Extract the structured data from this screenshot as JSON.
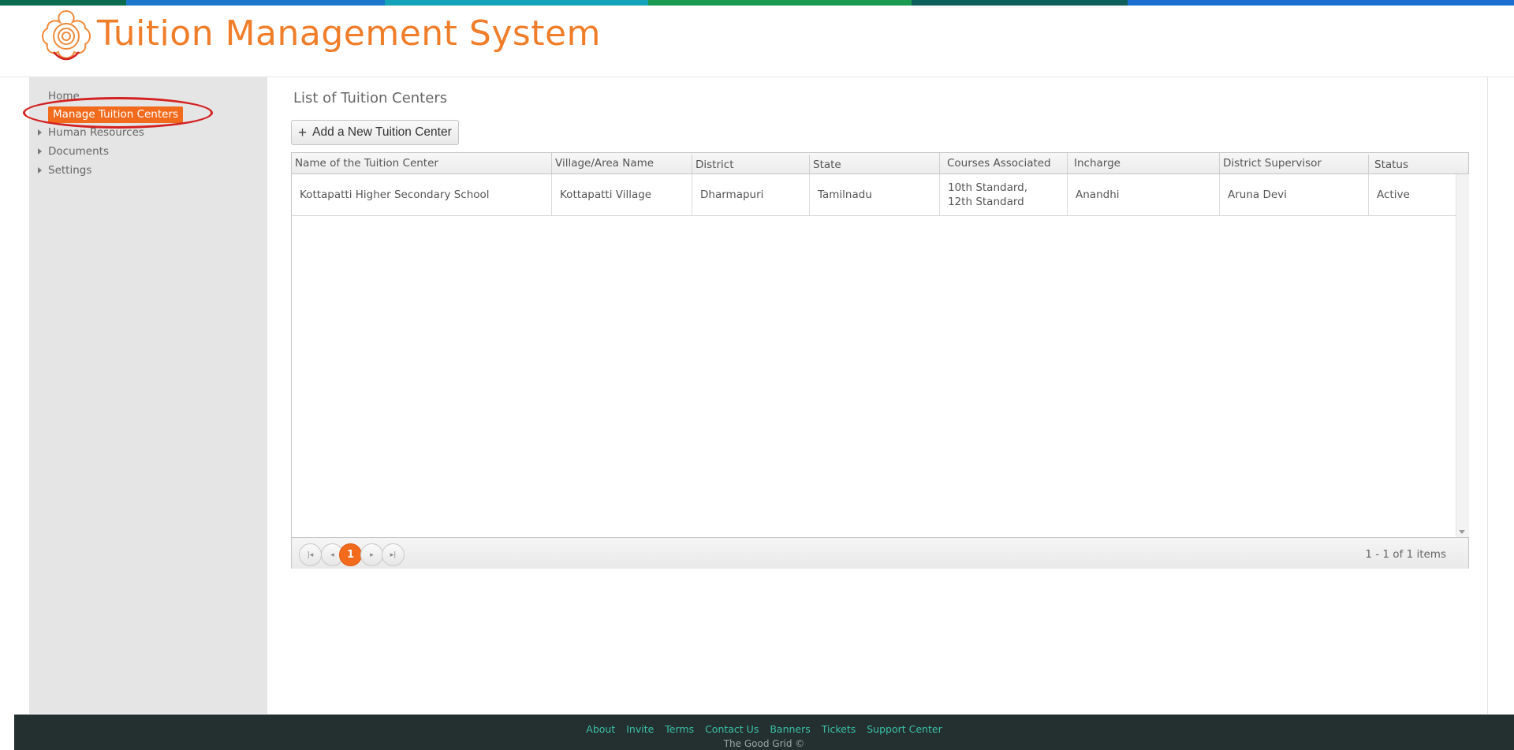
{
  "header": {
    "title": "Tuition Management System"
  },
  "colors": {
    "accent": "#f26b1d",
    "title": "#f07d2a",
    "footer_bg": "#243030",
    "footer_link": "#39c0a5",
    "sidebar_bg": "#e5e5e5",
    "top_strip": [
      "#0a6b4e",
      "#1976c8",
      "#14a3b8",
      "#1a9a50",
      "#0e5f5a",
      "#1c6fd0"
    ]
  },
  "sidebar": {
    "home": "Home",
    "active": "Manage Tuition  Centers",
    "items": [
      "Human Resources",
      "Documents",
      "Settings"
    ]
  },
  "main": {
    "title": "List of Tuition Centers",
    "add_button": "Add a New Tuition Center",
    "add_icon": "plus-icon"
  },
  "table": {
    "columns": [
      "Name of the Tuition Center",
      "Village/Area Name",
      "District",
      "State",
      "Courses Associated",
      "Incharge",
      "District Supervisor",
      "Status"
    ],
    "rows": [
      [
        "Kottapatti Higher Secondary School",
        "Kottapatti Village",
        "Dharmapuri",
        "Tamilnadu",
        "10th Standard,\n12th Standard",
        "Anandhi",
        "Aruna Devi",
        "Active"
      ]
    ]
  },
  "pager": {
    "current_page": "1",
    "info": "1 - 1 of 1 items",
    "first_icon": "first-page-icon",
    "prev_icon": "prev-page-icon",
    "next_icon": "next-page-icon",
    "last_icon": "last-page-icon"
  },
  "footer": {
    "links": [
      "About",
      "Invite",
      "Terms",
      "Contact Us",
      "Banners",
      "Tickets",
      "Support Center"
    ],
    "copyright": "The Good Grid ©"
  }
}
